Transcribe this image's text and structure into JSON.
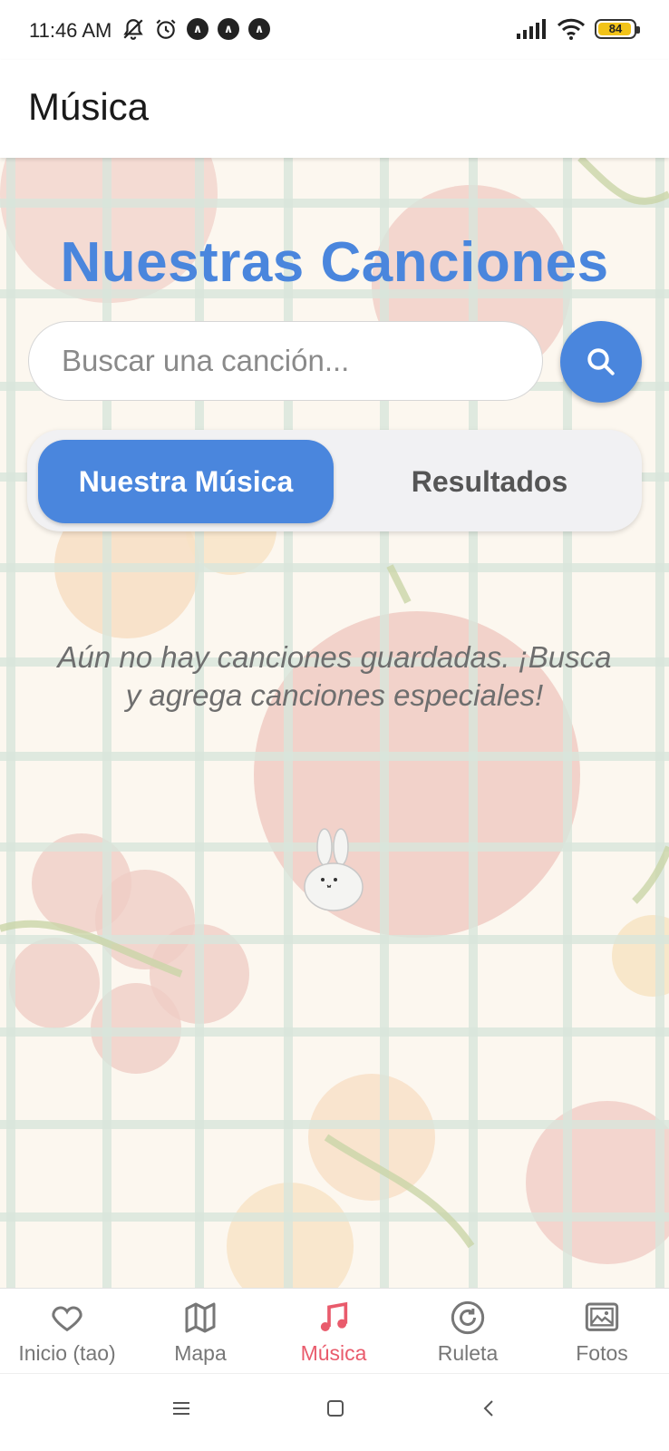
{
  "status_bar": {
    "time": "11:46 AM",
    "battery": "84"
  },
  "app_bar": {
    "title": "Música"
  },
  "main": {
    "heading": "Nuestras Canciones",
    "search_placeholder": "Buscar una canción...",
    "search_value": "",
    "tabs": [
      {
        "label": "Nuestra Música",
        "active": true
      },
      {
        "label": "Resultados",
        "active": false
      }
    ],
    "empty_message": "Aún no hay canciones guardadas. ¡Busca y agrega canciones especiales!"
  },
  "bottom_nav": {
    "items": [
      {
        "label": "Inicio (tao)",
        "icon": "heart-icon",
        "active": false
      },
      {
        "label": "Mapa",
        "icon": "map-icon",
        "active": false
      },
      {
        "label": "Música",
        "icon": "music-note-icon",
        "active": true
      },
      {
        "label": "Ruleta",
        "icon": "refresh-icon",
        "active": false
      },
      {
        "label": "Fotos",
        "icon": "photos-icon",
        "active": false
      }
    ]
  },
  "colors": {
    "accent_blue": "#4a86dd",
    "active_nav": "#e95b6c",
    "battery": "#f2c318"
  }
}
